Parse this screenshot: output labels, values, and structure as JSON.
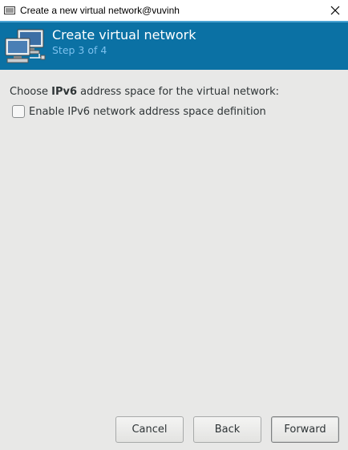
{
  "window": {
    "title": "Create a new virtual network@vuvinh",
    "app_icon": "virt-manager-icon",
    "close_icon": "close-icon"
  },
  "header": {
    "title": "Create virtual network",
    "subtitle": "Step 3 of 4",
    "icon": "network-computers-icon",
    "background": "#0b71a4"
  },
  "content": {
    "prompt_prefix": "Choose ",
    "prompt_bold": "IPv6",
    "prompt_suffix": " address space for the virtual network:",
    "enable_ipv6_label": "Enable IPv6 network address space definition",
    "enable_ipv6_checked": false
  },
  "buttons": {
    "cancel": "Cancel",
    "back": "Back",
    "forward": "Forward"
  }
}
